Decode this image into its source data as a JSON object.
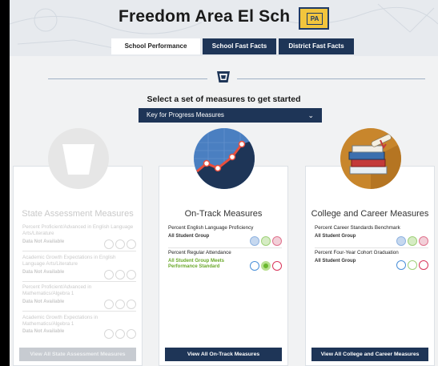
{
  "school_name": "Freedom Area El Sch",
  "badge_text": "PA",
  "tabs": [
    {
      "label": "School Performance",
      "active": true
    },
    {
      "label": "School Fast Facts",
      "active": false
    },
    {
      "label": "District Fast Facts",
      "active": false
    }
  ],
  "prompt": "Select a set of measures to get started",
  "select": {
    "value": "Key for Progress Measures"
  },
  "colors": {
    "navy": "#1e3557",
    "blue": "#4a90d9",
    "green": "#6ab82e",
    "red": "#d9365b",
    "gold": "#f2c53d"
  },
  "cards": [
    {
      "title": "State Assessment Measures",
      "disabled": true,
      "icon": "keystone-icon",
      "measures": [
        {
          "name": "Percent Proficient/Advanced in English Language Arts/Literature",
          "group": "Data Not Available"
        },
        {
          "name": "Academic Growth Expectations in English Language Arts/Literature",
          "group": "Data Not Available"
        },
        {
          "name": "Percent Proficient/Advanced in Mathematics/Algebra 1",
          "group": "Data Not Available"
        },
        {
          "name": "Academic Growth Expectations in Mathematics/Algebra 1",
          "group": "Data Not Available"
        }
      ],
      "button": "View All State Assessment Measures"
    },
    {
      "title": "On-Track Measures",
      "disabled": false,
      "icon": "trend-chart-icon",
      "measures": [
        {
          "name": "Percent English Language Proficiency",
          "group": "All Student Group",
          "status": "blue"
        },
        {
          "name": "Percent Regular Attendance",
          "group": "All Student Group Meets Performance Standard",
          "status": "green"
        }
      ],
      "button": "View All On-Track Measures"
    },
    {
      "title": "College and Career Measures",
      "disabled": false,
      "icon": "books-diploma-icon",
      "measures": [
        {
          "name": "Percent Career Standards Benchmark",
          "group": "All Student Group",
          "status": "none"
        },
        {
          "name": "Percent Four-Year Cohort Graduation",
          "group": "All Student Group",
          "status": "none"
        }
      ],
      "button": "View All College and Career Measures"
    }
  ]
}
